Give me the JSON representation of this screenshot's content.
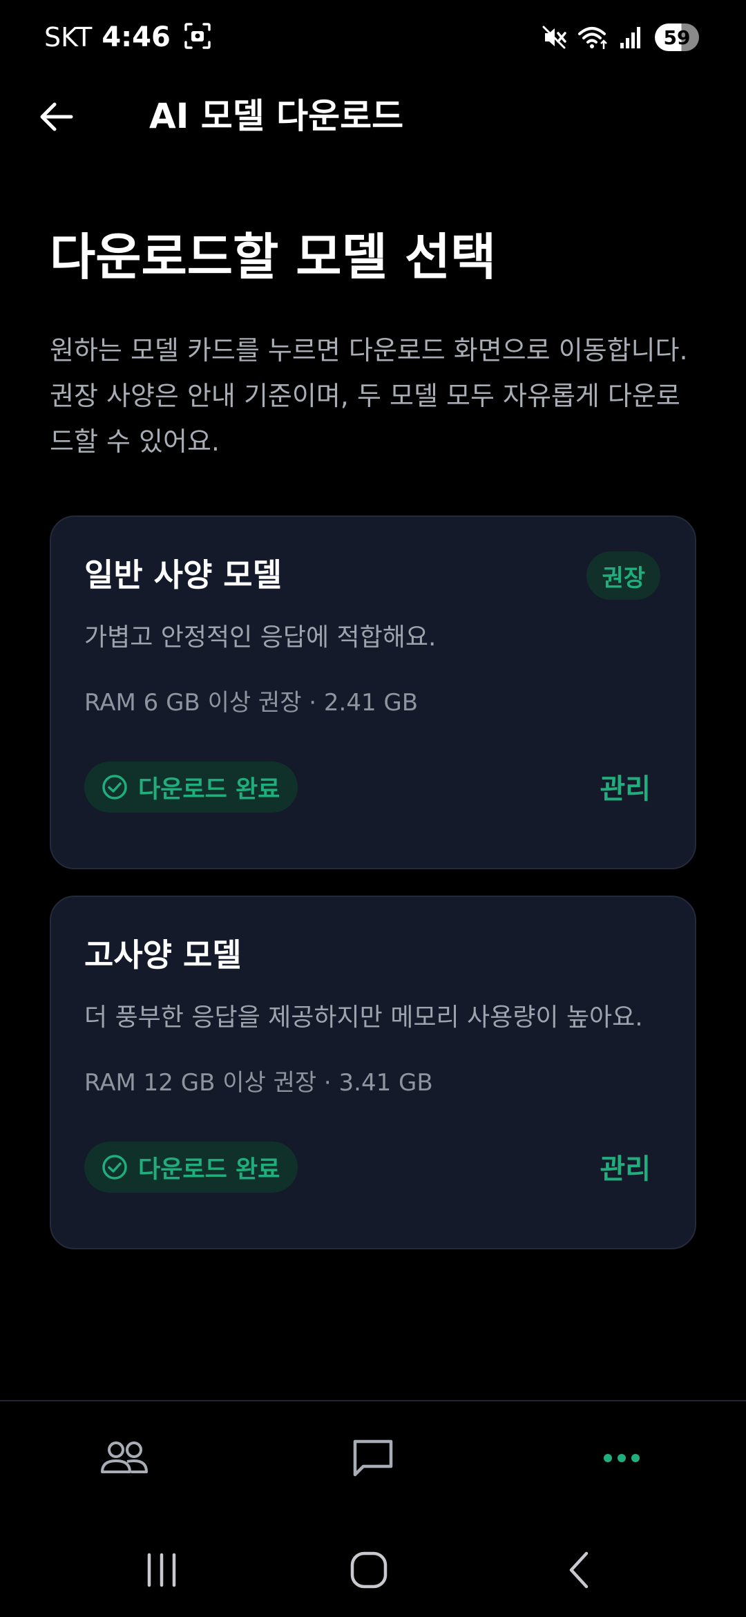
{
  "status_bar": {
    "carrier": "SKT",
    "time": "4:46",
    "battery": "59"
  },
  "app_bar": {
    "title": "AI 모델 다운로드"
  },
  "page": {
    "heading": "다운로드할 모델 선택",
    "description": "원하는 모델 카드를 누르면 다운로드 화면으로 이동합니다. 권장 사양은 안내 기준이며, 두 모델 모두 자유롭게 다운로드할 수 있어요."
  },
  "models": [
    {
      "title": "일반 사양 모델",
      "badge": "권장",
      "description": "가볍고 안정적인 응답에 적합해요.",
      "spec": "RAM 6 GB 이상 권장 · 2.41 GB",
      "status": "다운로드 완료",
      "action": "관리"
    },
    {
      "title": "고사양 모델",
      "description": "더 풍부한 응답을 제공하지만 메모리 사용량이 높아요.",
      "spec": "RAM 12 GB 이상 권장 · 3.41 GB",
      "status": "다운로드 완료",
      "action": "관리"
    }
  ],
  "bottom_nav": {
    "items": [
      {
        "icon": "people-icon",
        "active": false
      },
      {
        "icon": "chat-icon",
        "active": false
      },
      {
        "icon": "more-icon",
        "active": true
      }
    ]
  },
  "colors": {
    "background": "#000000",
    "card": "#141a29",
    "accent": "#1fae7c",
    "text_secondary": "#a9adb5"
  }
}
